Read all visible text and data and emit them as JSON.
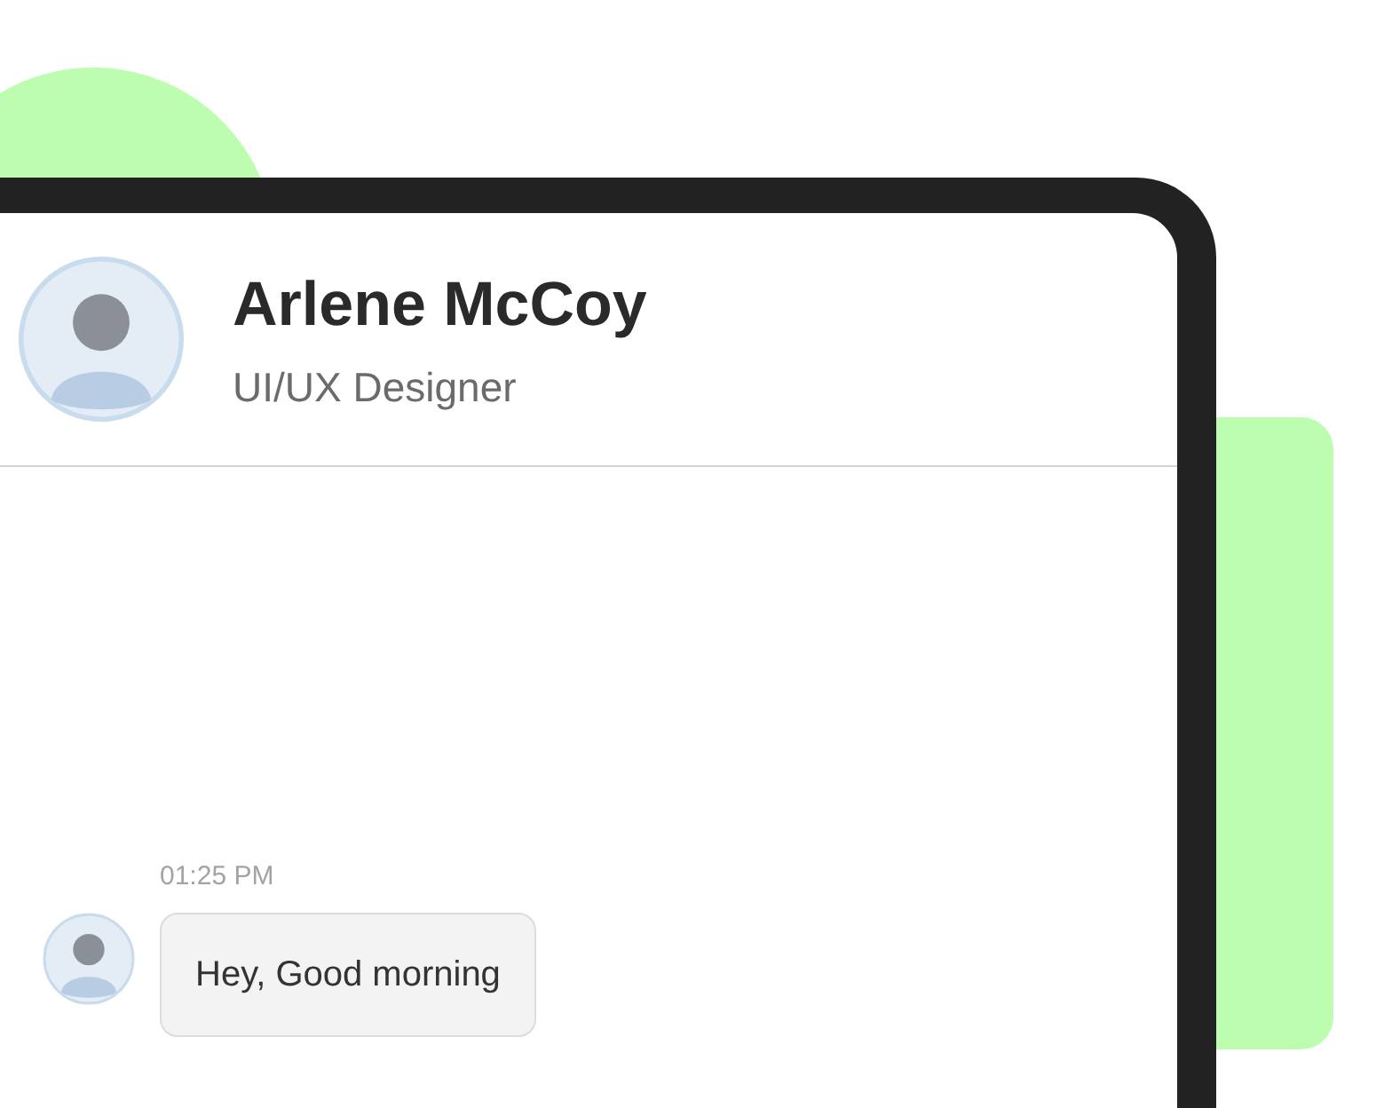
{
  "contact": {
    "name": "Arlene McCoy",
    "role": "UI/UX Designer"
  },
  "messages": [
    {
      "time": "01:25 PM",
      "text": "Hey, Good morning"
    }
  ]
}
